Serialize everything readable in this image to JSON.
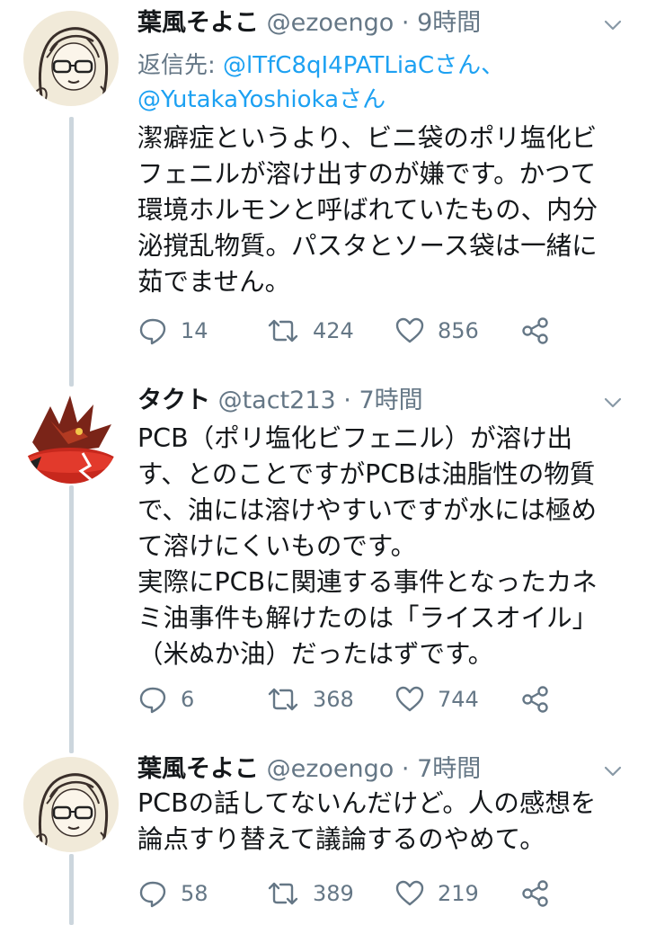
{
  "tweets": [
    {
      "name": "葉風そよこ",
      "handle": "@ezoengo",
      "separator": "·",
      "time": "9時間",
      "reply_prefix": "返信先: ",
      "reply_mention_1": "@lTfC8qI4PATLiaC",
      "reply_sep": "さん、",
      "reply_mention_2": "@YutakaYoshioka",
      "reply_suffix": "さん",
      "body": "潔癖症というより、ビニ袋のポリ塩化ビ\nフェニルが溶け出すのが嫌です。かつて\n環境ホルモンと呼ばれていたもの、内分\n泌撹乱物質。パスタとソース袋は一緒に\n茹でません。",
      "replies": "14",
      "retweets": "424",
      "likes": "856"
    },
    {
      "name": "タクト",
      "handle": "@tact213",
      "separator": "·",
      "time": "7時間",
      "body": "PCB（ポリ塩化ビフェニル）が溶け出\nす、とのことですがPCBは油脂性の物質\nで、油には溶けやすいですが水には極め\nて溶けにくいものです。\n実際にPCBに関連する事件となったカネ\nミ油事件も解けたのは「ライスオイル」\n（米ぬか油）だったはずです。",
      "replies": "6",
      "retweets": "368",
      "likes": "744"
    },
    {
      "name": "葉風そよこ",
      "handle": "@ezoengo",
      "separator": "·",
      "time": "7時間",
      "body": "PCBの話してないんだけど。人の感想を\n論点すり替えて議論するのやめて。",
      "replies": "58",
      "retweets": "389",
      "likes": "219"
    }
  ],
  "icons": {
    "reply": "reply-icon",
    "retweet": "retweet-icon",
    "like": "heart-icon",
    "share": "share-icon",
    "caret": "chevron-down-icon"
  },
  "colors": {
    "text": "#14171a",
    "secondary": "#657786",
    "link": "#1da1f2",
    "thread_line": "#ccd6dd"
  }
}
